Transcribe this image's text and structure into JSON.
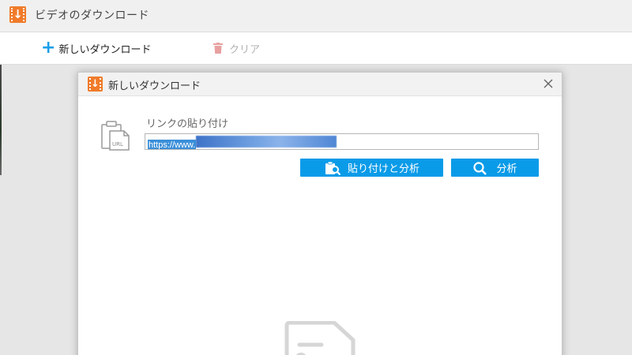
{
  "app": {
    "title": "ビデオのダウンロード",
    "logo_icon": "download-arrow-icon",
    "accent_color": "#f07b2a"
  },
  "toolbar": {
    "new_download_label": "新しいダウンロード",
    "clear_label": "クリア"
  },
  "dialog": {
    "title": "新しいダウンロード",
    "link_label": "リンクの貼り付け",
    "url_value": "https://www.",
    "paste_analyze_label": "貼り付けと分析",
    "analyze_label": "分析",
    "button_color": "#0a9be8"
  }
}
